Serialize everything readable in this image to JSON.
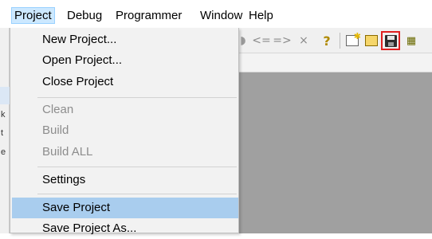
{
  "menubar": {
    "items": [
      {
        "label": "Project"
      },
      {
        "label": "Debug"
      },
      {
        "label": "Programmer"
      },
      {
        "label": "Window"
      },
      {
        "label": "Help"
      }
    ]
  },
  "toolbar": {
    "back_icon": "back-arrow",
    "forward_icon": "forward-arrow",
    "arrow_left": "<=",
    "arrow_right": "=>",
    "close_glyph": "×",
    "help_glyph": "?",
    "icons": [
      "new-project-icon",
      "open-project-icon",
      "save-project-icon",
      "build-all-icon"
    ],
    "highlight_color": "#e02020"
  },
  "left_panel": {
    "chars": [
      "k",
      "t",
      "e"
    ]
  },
  "project_menu": {
    "items": [
      {
        "label": "New Project...",
        "enabled": true
      },
      {
        "label": "Open Project...",
        "enabled": true
      },
      {
        "label": "Close Project",
        "enabled": true
      },
      {
        "label": "Clean",
        "enabled": false
      },
      {
        "label": "Build",
        "enabled": false
      },
      {
        "label": "Build ALL",
        "enabled": false
      },
      {
        "label": "Settings",
        "enabled": true
      },
      {
        "label": "Save Project",
        "enabled": true,
        "highlighted": true
      },
      {
        "label": "Save Project As...",
        "enabled": true
      }
    ]
  },
  "colors": {
    "menu_highlight": "#a9cdee",
    "active_menu": "#cce8ff",
    "workarea": "#a0a0a0"
  }
}
